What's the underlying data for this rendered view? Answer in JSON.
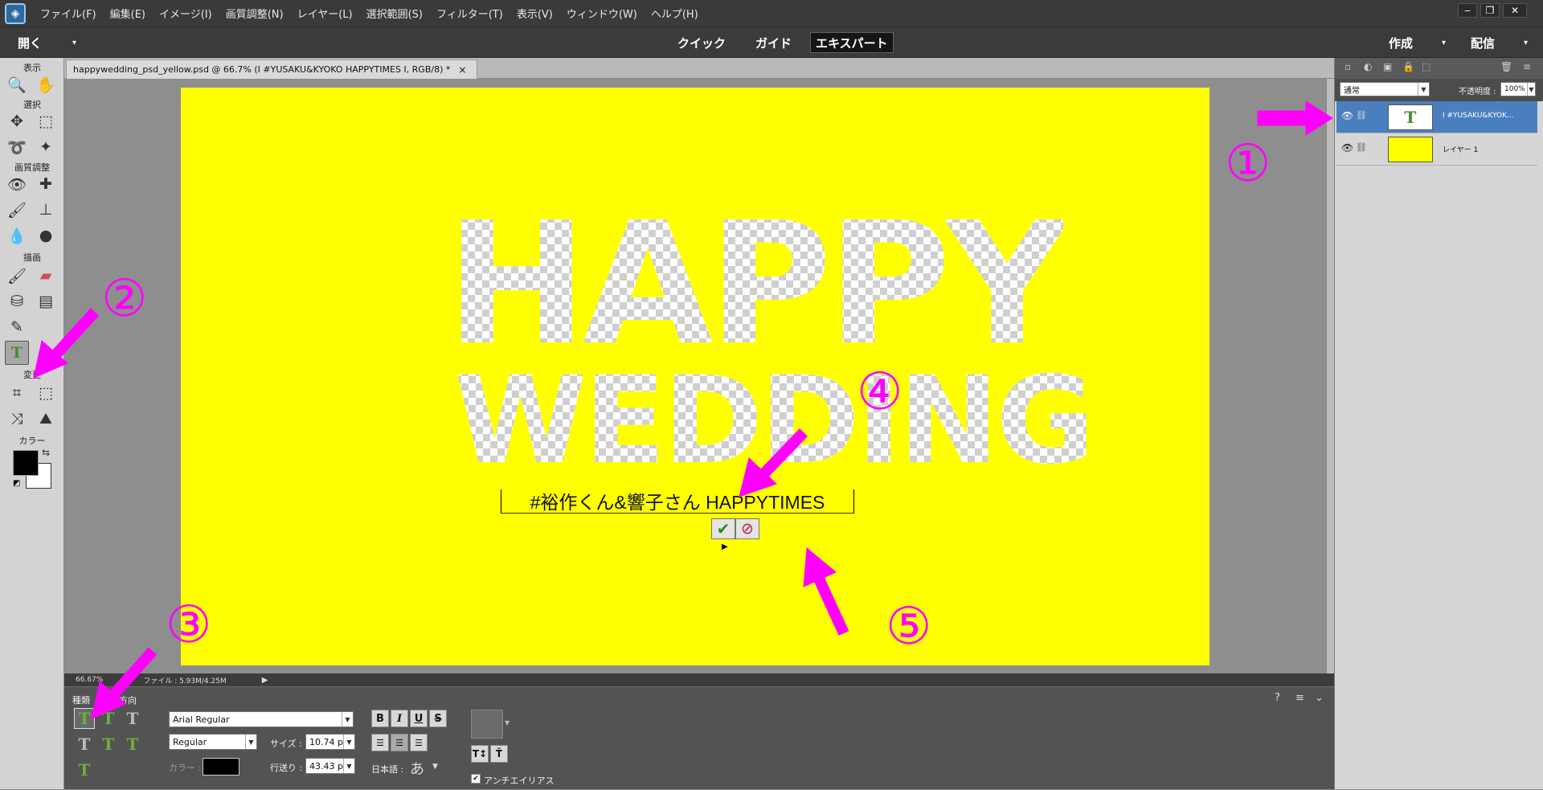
{
  "menu": [
    "ファイル(F)",
    "編集(E)",
    "イメージ(I)",
    "画質調整(N)",
    "レイヤー(L)",
    "選択範囲(S)",
    "フィルター(T)",
    "表示(V)",
    "ウィンドウ(W)",
    "ヘルプ(H)"
  ],
  "window_controls": {
    "minimize": "‒",
    "restore": "❐",
    "close": "✕"
  },
  "modebar": {
    "open": "開く",
    "quick": "クイック",
    "guide": "ガイド",
    "expert": "エキスパート",
    "create": "作成",
    "share": "配信"
  },
  "toolbox": {
    "view": "表示",
    "select": "選択",
    "enhance": "画質調整",
    "draw": "描画",
    "modify": "変更",
    "color": "カラー"
  },
  "document": {
    "tab_label": "happywedding_psd_yellow.psd @ 66.7% (I     #YUSAKU&KYOKO HAPPYTIMES      I, RGB/8) *",
    "close": "×"
  },
  "canvas": {
    "title_line1": "HAPPY",
    "title_line2": "WEDDING",
    "text_entry": "#裕作くん&響子さん HAPPYTIMES"
  },
  "status": {
    "zoom": "66.67%",
    "file": "ファイル : 5.93M/4.25M"
  },
  "options": {
    "type_label": "種類",
    "direction_label": "方向",
    "font_family": "Arial Regular",
    "font_style": "Regular",
    "size_label": "サイズ :",
    "size_value": "10.74 p",
    "color_label": "カラー :",
    "leading_label": "行送り :",
    "leading_value": "43.43 p",
    "bold": "B",
    "italic": "I",
    "underline": "U",
    "strike": "S",
    "japanese_label": "日本語 :",
    "antialias_label": "アンチエイリアス",
    "antialias_checked": true
  },
  "layers": {
    "blend_mode": "通常",
    "opacity_label": "不透明度 :",
    "opacity_value": "100%",
    "items": [
      {
        "name": "I    #YUSAKU&KYOK...",
        "selected": true
      },
      {
        "name": "レイヤー 1",
        "selected": false
      }
    ]
  },
  "annotations": [
    "①",
    "②",
    "③",
    "④",
    "⑤"
  ],
  "colors": {
    "canvas": "#ffff00",
    "annotation": "#ff00ff",
    "selected_layer": "#4a7fbf",
    "foreground": "#000000",
    "background": "#ffffff"
  }
}
